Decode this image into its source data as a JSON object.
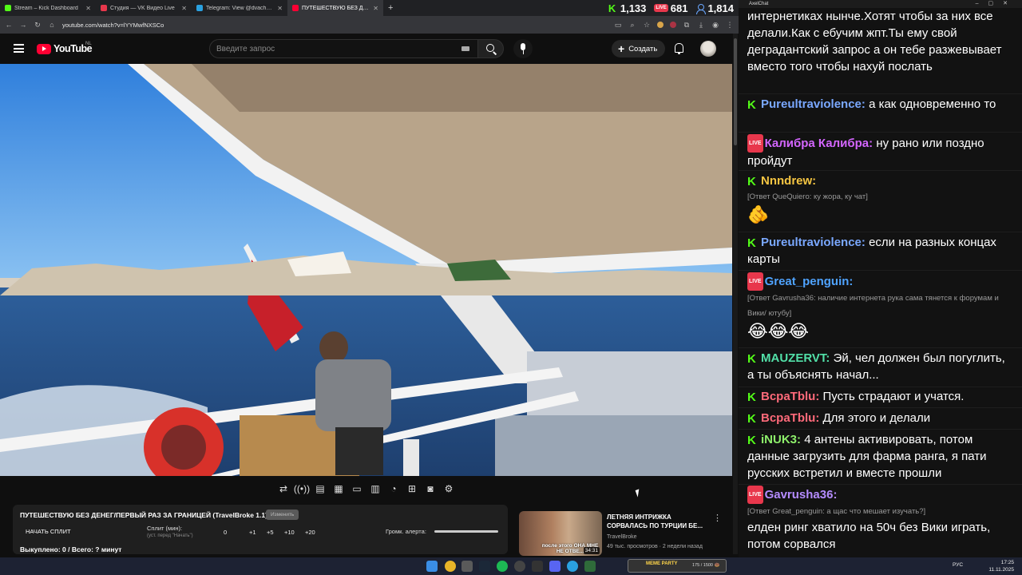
{
  "browser": {
    "tabs": [
      {
        "label": "Stream – Kick Dashboard",
        "color": "#53fc18",
        "active": false
      },
      {
        "label": "Студия — VK Видео Live",
        "color": "#e8374c",
        "active": false
      },
      {
        "label": "Telegram: View @dvachannel",
        "color": "#2aa1e0",
        "active": false
      },
      {
        "label": "ПУТЕШЕСТВУЮ БЕЗ ДЕНЕГ/ПЕ",
        "color": "#ff0033",
        "active": true
      }
    ],
    "new_tab": "+",
    "url": "youtube.com/watch?v=lYYMwfNXSCo",
    "counters": {
      "kick": "1,133",
      "vk_live_badge": "LIVE",
      "vk": "681",
      "total": "1,814"
    }
  },
  "youtube": {
    "logo": "YouTube",
    "region": "NL",
    "search_placeholder": "Введите запрос",
    "create_label": "Создать"
  },
  "player_controls": [
    "loop-icon",
    "broadcast-icon",
    "overlay-icon",
    "clapper-icon",
    "screen-icon",
    "grid-icon",
    "speedometer-icon",
    "plus-box-icon",
    "camera-icon",
    "gear-icon"
  ],
  "split_panel": {
    "title": "ПУТЕШЕСТВУЮ БЕЗ ДЕНЕГ/ПЕРВЫЙ РАЗ ЗА ГРАНИЦЕЙ (TravelBroke 1.1)",
    "badge": "Изменить",
    "start_label": "НАЧАТЬ СПЛИТ",
    "split_label": "Сплит (мин):",
    "split_sub": "(уст. перед \"Начать\")",
    "split_values": [
      "0",
      "+1",
      "+5",
      "+10",
      "+20"
    ],
    "alert_label": "Громк. алерта:",
    "alert_volume": 0.9,
    "bought": "Выкуплено: 0 / Всего: ? минут"
  },
  "recommended": {
    "title": "ЛЕТНЯЯ ИНТРИЖКА СОРВАЛАСЬ ПО ТУРЦИИ БЕ...",
    "channel": "TravelBroke",
    "meta": "49 тыс. просмотров · 2 недели назад",
    "duration": "34:31",
    "thumb_caption": "после этого ОНА МНЕ НЕ ОТВЕ..."
  },
  "chat": {
    "app_title": "AxelChat",
    "messages": [
      {
        "platform": "",
        "nick": "",
        "color": "#ffffff",
        "reply": "",
        "text": "интернетиках нынче.Хотят чтобы за них все делали.Как с ебучим жпт.Ты ему свой деградантский запрос а он тебе разжевывает вместо того чтобы нахуй послать",
        "emoji": ""
      },
      {
        "platform": "kick",
        "nick": "Pureultraviolence:",
        "color": "#7aa8ff",
        "reply": "",
        "text": "а как одновременно то",
        "emoji": ""
      },
      {
        "platform": "vk",
        "nick": "Калибра Калибра:",
        "color": "#d466ff",
        "reply": "",
        "text": "ну рано или поздно пройдут",
        "emoji": ""
      },
      {
        "platform": "kick",
        "nick": "Nnndrew:",
        "color": "#f5c542",
        "reply": "[Ответ QueQuiero: ку жора, ку чат]",
        "text": "",
        "emoji": "🫵"
      },
      {
        "platform": "kick",
        "nick": "Pureultraviolence:",
        "color": "#7aa8ff",
        "reply": "",
        "text": "если на разных концах карты",
        "emoji": ""
      },
      {
        "platform": "vk",
        "nick": "Great_penguin:",
        "color": "#4fa3ff",
        "reply": "[Ответ Gavrusha36: наличие интернета рука сама тянется к форумам и Вики/ ютубу]",
        "text": "",
        "emoji": "😂😂😂"
      },
      {
        "platform": "kick",
        "nick": "MAUZERVT:",
        "color": "#52e0a8",
        "reply": "",
        "text": "Эй, чел должен был погуглить, а ты объяснять начал...",
        "emoji": ""
      },
      {
        "platform": "kick",
        "nick": "ВсраТblu:",
        "color": "#ff6a7a",
        "reply": "",
        "text": "Пусть страдают и учатся.",
        "emoji": ""
      },
      {
        "platform": "kick",
        "nick": "ВсраТblu:",
        "color": "#ff6a7a",
        "reply": "",
        "text": "Для этого и делали",
        "emoji": ""
      },
      {
        "platform": "kick",
        "nick": "iNUK3:",
        "color": "#8ef06b",
        "reply": "",
        "text": "4 антены активировать, потом данные загрузить для фарма ранга, я пати русских встретил и вместе прошли",
        "emoji": ""
      },
      {
        "platform": "vk",
        "nick": "Gavrusha36:",
        "color": "#b58cff",
        "reply": "[Ответ Great_penguin: а щас что мешает изучать?]",
        "text": "елден ринг хватило на 50ч без Вики играть, потом сорвался",
        "emoji": ""
      }
    ]
  },
  "taskbar": {
    "lang": "РУС",
    "time": "17:25",
    "date": "11.11.2025",
    "widget_title": "MEME PARTY",
    "widget_progress": "175 / 1500 🍩"
  }
}
